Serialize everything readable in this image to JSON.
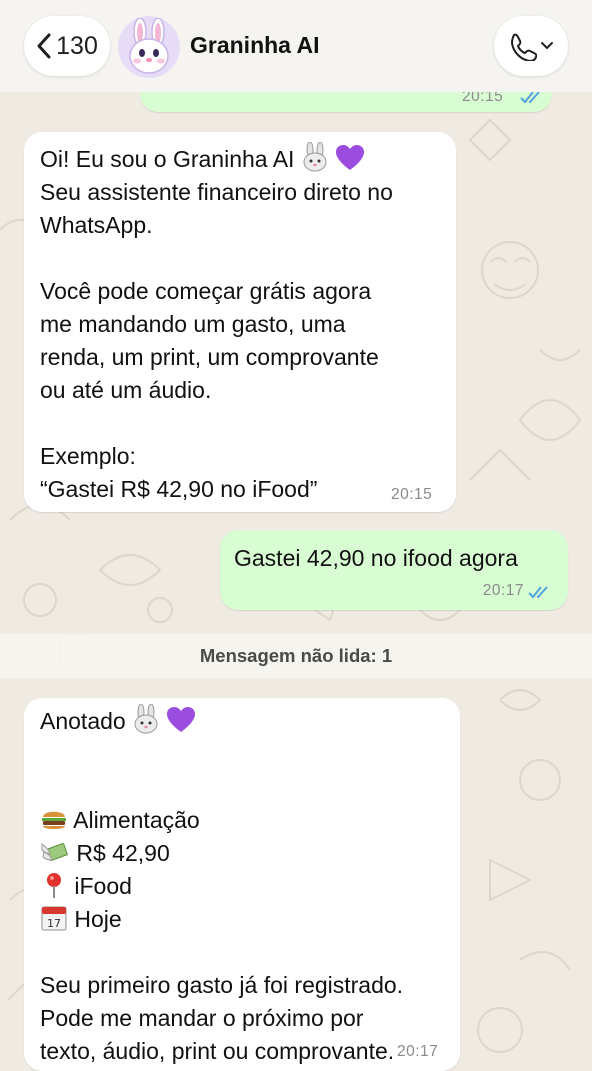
{
  "header": {
    "back_count": "130",
    "contact_name": "Graninha AI",
    "avatar": "rabbit-face-icon",
    "call_icon": "phone-icon"
  },
  "messages": [
    {
      "direction": "incoming",
      "line1": "Oi! Eu sou o Graninha AI",
      "line1_emojis": [
        "rabbit-face-icon",
        "purple-heart-icon"
      ],
      "rest": "Seu assistente financeiro direto no\nWhatsApp.\n\nVocê pode começar grátis agora\nme mandando um gasto, uma\nrenda, um print, um comprovante\nou até um áudio.\n\nExemplo:\n“Gastei R$ 42,90 no iFood”",
      "time": "20:15"
    },
    {
      "direction": "outgoing",
      "text": "Gastei 42,90 no ifood agora",
      "time": "20:17",
      "status": "read"
    },
    {
      "direction": "incoming",
      "title": "Anotado",
      "title_emojis": [
        "rabbit-face-icon",
        "purple-heart-icon"
      ],
      "items": [
        {
          "icon": "hamburger-icon",
          "label": "Alimentação"
        },
        {
          "icon": "money-wings-icon",
          "label": "R$ 42,90"
        },
        {
          "icon": "pin-icon",
          "label": "iFood"
        },
        {
          "icon": "calendar-icon",
          "label": "Hoje"
        }
      ],
      "footer": "Seu primeiro gasto já foi registrado.\nPode me mandar o próximo por\ntexto, áudio, print ou comprovante.",
      "time": "20:17"
    }
  ],
  "previous_message": {
    "time": "20:15",
    "status": "read"
  },
  "unread_label": "Mensagem não lida: 1",
  "colors": {
    "background": "#efeae2",
    "outgoing_bubble": "#d9fdd3",
    "incoming_bubble": "#ffffff",
    "read_ticks": "#4fa3e0",
    "purple_heart": "#9b4de0"
  }
}
